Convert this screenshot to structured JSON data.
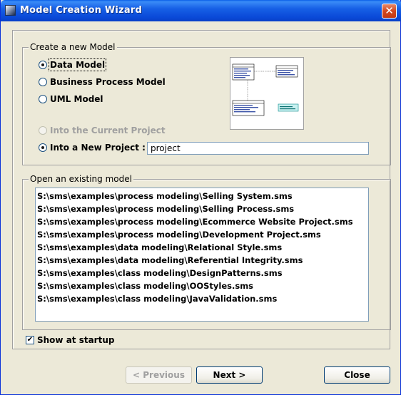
{
  "window": {
    "title": "Model Creation Wizard",
    "close_label": "✕"
  },
  "create": {
    "legend": "Create a new Model",
    "types": [
      {
        "label": "Data Model",
        "selected": true
      },
      {
        "label": "Business Process Model",
        "selected": false
      },
      {
        "label": "UML Model",
        "selected": false
      }
    ],
    "current_project_label": "Into the Current Project",
    "new_project_label": "Into a New Project :",
    "new_project_value": "project"
  },
  "open": {
    "legend": "Open an existing model",
    "items": [
      "S:\\sms\\examples\\process modeling\\Selling System.sms",
      "S:\\sms\\examples\\process modeling\\Selling Process.sms",
      "S:\\sms\\examples\\process modeling\\Ecommerce Website Project.sms",
      "S:\\sms\\examples\\process modeling\\Development Project.sms",
      "S:\\sms\\examples\\data modeling\\Relational Style.sms",
      "S:\\sms\\examples\\data modeling\\Referential Integrity.sms",
      "S:\\sms\\examples\\class modeling\\DesignPatterns.sms",
      "S:\\sms\\examples\\class modeling\\OOStyles.sms",
      "S:\\sms\\examples\\class modeling\\JavaValidation.sms"
    ]
  },
  "startup": {
    "label": "Show at startup",
    "checked": true,
    "check_glyph": "✔"
  },
  "buttons": {
    "previous": "< Previous",
    "next": "Next >",
    "close": "Close"
  }
}
